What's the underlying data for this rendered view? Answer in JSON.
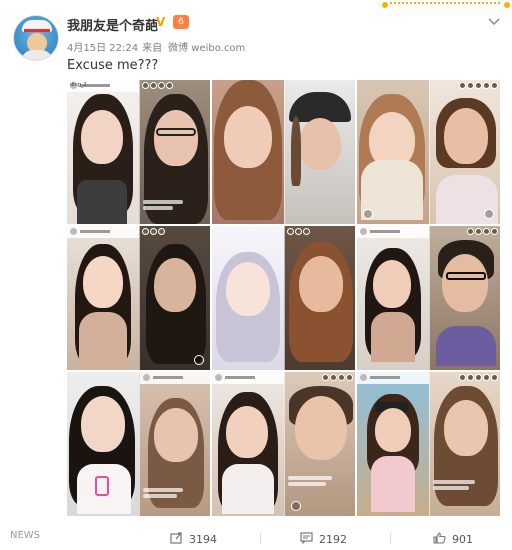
{
  "post": {
    "username": "我朋友是个奇葩",
    "verified_icon": "verified-v-icon",
    "level_badge": "6",
    "date": "4月15日 22:24",
    "source_prefix": "来自",
    "source": "微博 weibo.com",
    "text": "Excuse me???"
  },
  "actions": {
    "repost_count": "3194",
    "comment_count": "2192",
    "like_count": "901"
  },
  "watermark": "NEWS",
  "colors": {
    "verified": "#f5a200",
    "level_badge": "#ff8140",
    "meta_text": "#808080",
    "accent_deco": "#f5b400"
  },
  "images": [
    {
      "name": "photo-1",
      "labels": [
        "dlng_2"
      ]
    },
    {
      "name": "photo-2",
      "labels": []
    },
    {
      "name": "photo-3",
      "labels": []
    },
    {
      "name": "photo-4",
      "labels": []
    },
    {
      "name": "photo-5",
      "labels": []
    },
    {
      "name": "photo-6",
      "labels": []
    },
    {
      "name": "photo-7",
      "labels": []
    },
    {
      "name": "photo-8",
      "labels": []
    },
    {
      "name": "photo-9",
      "labels": []
    }
  ]
}
